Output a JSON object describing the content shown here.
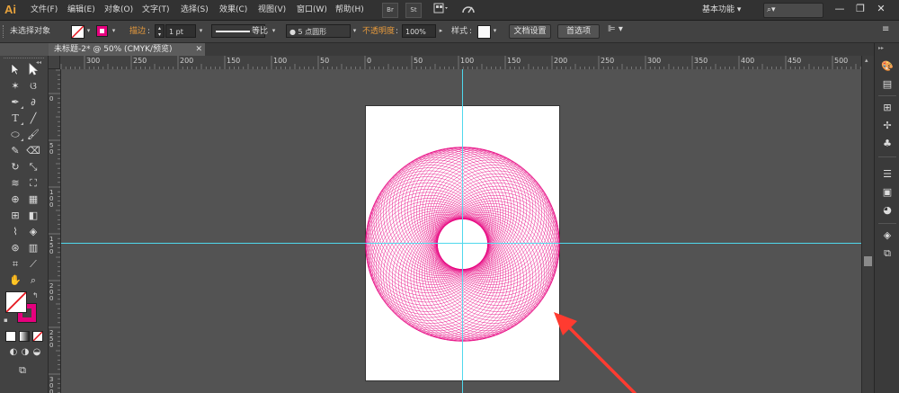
{
  "app": {
    "logo": "Ai"
  },
  "menu": [
    {
      "label": "文件(F)"
    },
    {
      "label": "编辑(E)"
    },
    {
      "label": "对象(O)"
    },
    {
      "label": "文字(T)"
    },
    {
      "label": "选择(S)"
    },
    {
      "label": "效果(C)"
    },
    {
      "label": "视图(V)"
    },
    {
      "label": "窗口(W)"
    },
    {
      "label": "帮助(H)"
    }
  ],
  "menubar_icons": {
    "bridge": "Br",
    "stock": "St",
    "arrange": "arrange-documents-icon",
    "gpu": "gpu-icon"
  },
  "workspace": {
    "label": "基本功能 ▾"
  },
  "search": {
    "placeholder": ""
  },
  "window_controls": {
    "minimize": "—",
    "restore": "❐",
    "close": "✕"
  },
  "controlbar": {
    "selection_status": "未选择对象",
    "stroke_label": "描边",
    "stroke_weight": "1 pt",
    "profile_label": "等比",
    "brush_label": "● 5 点圆形",
    "opacity_label": "不透明度",
    "opacity_value": "100%",
    "style_label": "样式",
    "doc_settings": "文档设置",
    "preferences": "首选项"
  },
  "document_tab": {
    "title": "未标题-2* @ 50% (CMYK/预览)"
  },
  "ruler_h_labels": [
    "300",
    "250",
    "200",
    "150",
    "100",
    "50",
    "0",
    "50",
    "100",
    "150",
    "200",
    "250",
    "300",
    "350",
    "400",
    "450",
    "500"
  ],
  "ruler_v_labels": [
    "0",
    "5 0",
    "1 0 0",
    "1 5 0",
    "2 0 0",
    "2 5 0",
    "3 0 0"
  ],
  "colors": {
    "accent_orange": "#e79a3c",
    "guide_cyan": "#4fd8ec",
    "art_magenta": "#e6007e",
    "arrow_red": "#ff3b30",
    "fill_swatch": "#ffffff",
    "stroke_swatch": "#e6007e"
  },
  "artwork": {
    "type": "spirograph-ring",
    "circle_count": 72
  }
}
